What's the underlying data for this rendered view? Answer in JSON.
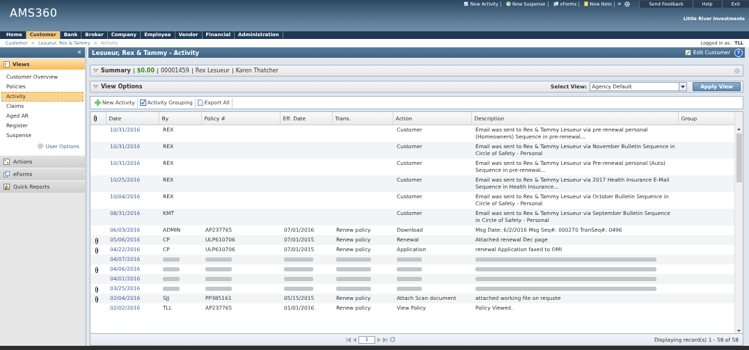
{
  "app": {
    "logo": "AMS360",
    "company": "Little River Investments"
  },
  "quick_links": [
    {
      "label": "New Activity"
    },
    {
      "label": "New Suspense"
    },
    {
      "label": "eForms"
    },
    {
      "label": "New Note"
    }
  ],
  "quick_more": "»",
  "top_buttons": [
    "Send Feedback",
    "Help",
    "Exit"
  ],
  "nav": [
    {
      "label": "Home",
      "selected": false
    },
    {
      "label": "Customer",
      "selected": true
    },
    {
      "label": "Bank",
      "selected": false
    },
    {
      "label": "Broker",
      "selected": false
    },
    {
      "label": "Company",
      "selected": false
    },
    {
      "label": "Employee",
      "selected": false
    },
    {
      "label": "Vendor",
      "selected": false
    },
    {
      "label": "Financial",
      "selected": false
    },
    {
      "label": "Administration",
      "selected": false
    }
  ],
  "breadcrumb": {
    "items": [
      "Customer",
      "Lesueur, Rex & Tammy",
      "Activity"
    ],
    "separators": [
      ">",
      ">"
    ]
  },
  "logged_in": {
    "label": "Logged in as:",
    "user": "TLL"
  },
  "sidebar": {
    "collapse": "«",
    "views_title": "Views",
    "views": [
      {
        "label": "Customer Overview",
        "selected": false
      },
      {
        "label": "Policies",
        "selected": false
      },
      {
        "label": "Activity",
        "selected": true
      },
      {
        "label": "Claims",
        "selected": false
      },
      {
        "label": "Aged AR",
        "selected": false
      },
      {
        "label": "Register",
        "selected": false
      },
      {
        "label": "Suspense",
        "selected": false
      }
    ],
    "user_options": "User Options",
    "sections": [
      "Actions",
      "eForms",
      "Quick Reports"
    ]
  },
  "page": {
    "title": "Lesueur, Rex & Tammy - Activity",
    "edit": "Edit Customer",
    "help": "?"
  },
  "summary": {
    "label": "Summary",
    "amount": "$0.00",
    "number": "00001459",
    "names": [
      "Rex Lesueur",
      "Karen Thatcher"
    ]
  },
  "view_options": {
    "label": "View Options",
    "select_label": "Select View:",
    "select_value": "Agency Default",
    "apply": "Apply View"
  },
  "toolbar": [
    "New Activity",
    "Activity Grouping",
    "Export All"
  ],
  "table": {
    "columns": [
      "Date",
      "By",
      "Policy #",
      "Eff. Date",
      "Trans.",
      "Action",
      "Description",
      "Group"
    ],
    "rows": [
      {
        "attachment": false,
        "blurred": false,
        "date": "10/31/2016",
        "by": "REX",
        "policy": "",
        "eff_date": "",
        "trans": "",
        "action": "Customer",
        "description": "Email was sent to Rex & Tammy Lesueur via pre-renewal personal (Homeowners) Sequence in pre-renewal..."
      },
      {
        "attachment": false,
        "blurred": false,
        "date": "10/31/2016",
        "by": "REX",
        "policy": "",
        "eff_date": "",
        "trans": "",
        "action": "Customer",
        "description": "Email was sent to Rex & Tammy Lesueur via November Bulletin Sequence in Circle of Safety - Personal"
      },
      {
        "attachment": false,
        "blurred": false,
        "date": "10/31/2016",
        "by": "REX",
        "policy": "",
        "eff_date": "",
        "trans": "",
        "action": "Customer",
        "description": "Email was sent to Rex & Tammy Lesueur via Pre-renewal personal (Auto) Sequence in pre-renewal..."
      },
      {
        "attachment": false,
        "blurred": false,
        "date": "10/25/2016",
        "by": "REX",
        "policy": "",
        "eff_date": "",
        "trans": "",
        "action": "Customer",
        "description": "Email was sent to Rex & Tammy Lesueur via 2017 Health Insurance E-Mail Sequence in Health Insurance..."
      },
      {
        "attachment": false,
        "blurred": false,
        "date": "10/04/2016",
        "by": "REX",
        "policy": "",
        "eff_date": "",
        "trans": "",
        "action": "Customer",
        "description": "Email was sent to Rex & Tammy Lesueur via October Bulletin Sequence in Circle of Safety - Personal"
      },
      {
        "attachment": false,
        "blurred": false,
        "date": "08/31/2016",
        "by": "KMT",
        "policy": "",
        "eff_date": "",
        "trans": "",
        "action": "Customer",
        "description": "Email was sent to Rex & Tammy Lesueur via September Bulletin Sequence in Circle of Safety - Personal"
      },
      {
        "attachment": false,
        "blurred": false,
        "date": "06/03/2016",
        "by": "ADMIN",
        "policy": "AP237765",
        "eff_date": "07/01/2016",
        "trans": "Renew policy",
        "action": "Download",
        "description": "Msg Date: 6/2/2016 Msg Seq#: 000270 TranSeq#: 0496"
      },
      {
        "attachment": true,
        "blurred": false,
        "date": "05/06/2016",
        "by": "CP",
        "policy": "ULP610706",
        "eff_date": "07/01/2015",
        "trans": "Renew policy",
        "action": "Renewal",
        "description": "Attached renewal Dec page"
      },
      {
        "attachment": true,
        "blurred": false,
        "date": "04/22/2016",
        "by": "CP",
        "policy": "ULP610706",
        "eff_date": "07/01/2015",
        "trans": "Renew policy",
        "action": "Application",
        "description": "renewal Application faxed to OMI"
      },
      {
        "attachment": false,
        "blurred": true,
        "date": "04/07/2016"
      },
      {
        "attachment": true,
        "blurred": true,
        "date": "04/06/2016"
      },
      {
        "attachment": false,
        "blurred": true,
        "date": "04/01/2016"
      },
      {
        "attachment": true,
        "blurred": true,
        "date": "03/25/2016"
      },
      {
        "attachment": true,
        "blurred": false,
        "date": "02/04/2016",
        "by": "SJJ",
        "policy": "PP385161",
        "eff_date": "05/15/2015",
        "trans": "Renew policy",
        "action": "Attach Scan document",
        "description": "attached working file on requote"
      },
      {
        "attachment": false,
        "blurred": false,
        "date": "02/02/2016",
        "by": "TLL",
        "policy": "AP237765",
        "eff_date": "01/01/2016",
        "trans": "Renew policy",
        "action": "View Policy",
        "description": "Policy Viewed."
      }
    ]
  },
  "pager": {
    "page": "1",
    "status": "Displaying record(s) 1 - 58 of 58"
  }
}
